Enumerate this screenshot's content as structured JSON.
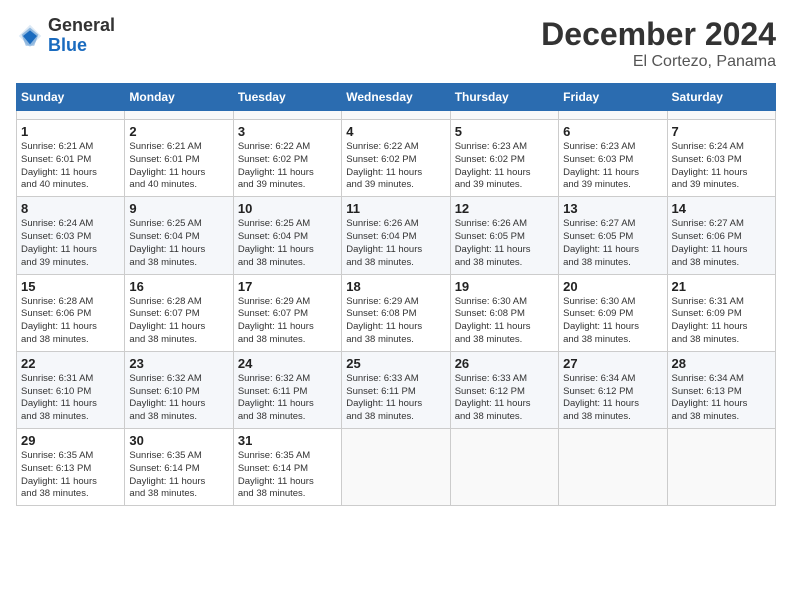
{
  "header": {
    "logo_general": "General",
    "logo_blue": "Blue",
    "month_title": "December 2024",
    "location": "El Cortezo, Panama"
  },
  "calendar": {
    "days_of_week": [
      "Sunday",
      "Monday",
      "Tuesday",
      "Wednesday",
      "Thursday",
      "Friday",
      "Saturday"
    ],
    "weeks": [
      [
        {
          "day": "",
          "info": ""
        },
        {
          "day": "",
          "info": ""
        },
        {
          "day": "",
          "info": ""
        },
        {
          "day": "",
          "info": ""
        },
        {
          "day": "",
          "info": ""
        },
        {
          "day": "",
          "info": ""
        },
        {
          "day": "",
          "info": ""
        }
      ],
      [
        {
          "day": "1",
          "info": "Sunrise: 6:21 AM\nSunset: 6:01 PM\nDaylight: 11 hours\nand 40 minutes."
        },
        {
          "day": "2",
          "info": "Sunrise: 6:21 AM\nSunset: 6:01 PM\nDaylight: 11 hours\nand 40 minutes."
        },
        {
          "day": "3",
          "info": "Sunrise: 6:22 AM\nSunset: 6:02 PM\nDaylight: 11 hours\nand 39 minutes."
        },
        {
          "day": "4",
          "info": "Sunrise: 6:22 AM\nSunset: 6:02 PM\nDaylight: 11 hours\nand 39 minutes."
        },
        {
          "day": "5",
          "info": "Sunrise: 6:23 AM\nSunset: 6:02 PM\nDaylight: 11 hours\nand 39 minutes."
        },
        {
          "day": "6",
          "info": "Sunrise: 6:23 AM\nSunset: 6:03 PM\nDaylight: 11 hours\nand 39 minutes."
        },
        {
          "day": "7",
          "info": "Sunrise: 6:24 AM\nSunset: 6:03 PM\nDaylight: 11 hours\nand 39 minutes."
        }
      ],
      [
        {
          "day": "8",
          "info": "Sunrise: 6:24 AM\nSunset: 6:03 PM\nDaylight: 11 hours\nand 39 minutes."
        },
        {
          "day": "9",
          "info": "Sunrise: 6:25 AM\nSunset: 6:04 PM\nDaylight: 11 hours\nand 38 minutes."
        },
        {
          "day": "10",
          "info": "Sunrise: 6:25 AM\nSunset: 6:04 PM\nDaylight: 11 hours\nand 38 minutes."
        },
        {
          "day": "11",
          "info": "Sunrise: 6:26 AM\nSunset: 6:04 PM\nDaylight: 11 hours\nand 38 minutes."
        },
        {
          "day": "12",
          "info": "Sunrise: 6:26 AM\nSunset: 6:05 PM\nDaylight: 11 hours\nand 38 minutes."
        },
        {
          "day": "13",
          "info": "Sunrise: 6:27 AM\nSunset: 6:05 PM\nDaylight: 11 hours\nand 38 minutes."
        },
        {
          "day": "14",
          "info": "Sunrise: 6:27 AM\nSunset: 6:06 PM\nDaylight: 11 hours\nand 38 minutes."
        }
      ],
      [
        {
          "day": "15",
          "info": "Sunrise: 6:28 AM\nSunset: 6:06 PM\nDaylight: 11 hours\nand 38 minutes."
        },
        {
          "day": "16",
          "info": "Sunrise: 6:28 AM\nSunset: 6:07 PM\nDaylight: 11 hours\nand 38 minutes."
        },
        {
          "day": "17",
          "info": "Sunrise: 6:29 AM\nSunset: 6:07 PM\nDaylight: 11 hours\nand 38 minutes."
        },
        {
          "day": "18",
          "info": "Sunrise: 6:29 AM\nSunset: 6:08 PM\nDaylight: 11 hours\nand 38 minutes."
        },
        {
          "day": "19",
          "info": "Sunrise: 6:30 AM\nSunset: 6:08 PM\nDaylight: 11 hours\nand 38 minutes."
        },
        {
          "day": "20",
          "info": "Sunrise: 6:30 AM\nSunset: 6:09 PM\nDaylight: 11 hours\nand 38 minutes."
        },
        {
          "day": "21",
          "info": "Sunrise: 6:31 AM\nSunset: 6:09 PM\nDaylight: 11 hours\nand 38 minutes."
        }
      ],
      [
        {
          "day": "22",
          "info": "Sunrise: 6:31 AM\nSunset: 6:10 PM\nDaylight: 11 hours\nand 38 minutes."
        },
        {
          "day": "23",
          "info": "Sunrise: 6:32 AM\nSunset: 6:10 PM\nDaylight: 11 hours\nand 38 minutes."
        },
        {
          "day": "24",
          "info": "Sunrise: 6:32 AM\nSunset: 6:11 PM\nDaylight: 11 hours\nand 38 minutes."
        },
        {
          "day": "25",
          "info": "Sunrise: 6:33 AM\nSunset: 6:11 PM\nDaylight: 11 hours\nand 38 minutes."
        },
        {
          "day": "26",
          "info": "Sunrise: 6:33 AM\nSunset: 6:12 PM\nDaylight: 11 hours\nand 38 minutes."
        },
        {
          "day": "27",
          "info": "Sunrise: 6:34 AM\nSunset: 6:12 PM\nDaylight: 11 hours\nand 38 minutes."
        },
        {
          "day": "28",
          "info": "Sunrise: 6:34 AM\nSunset: 6:13 PM\nDaylight: 11 hours\nand 38 minutes."
        }
      ],
      [
        {
          "day": "29",
          "info": "Sunrise: 6:35 AM\nSunset: 6:13 PM\nDaylight: 11 hours\nand 38 minutes."
        },
        {
          "day": "30",
          "info": "Sunrise: 6:35 AM\nSunset: 6:14 PM\nDaylight: 11 hours\nand 38 minutes."
        },
        {
          "day": "31",
          "info": "Sunrise: 6:35 AM\nSunset: 6:14 PM\nDaylight: 11 hours\nand 38 minutes."
        },
        {
          "day": "",
          "info": ""
        },
        {
          "day": "",
          "info": ""
        },
        {
          "day": "",
          "info": ""
        },
        {
          "day": "",
          "info": ""
        }
      ]
    ]
  }
}
